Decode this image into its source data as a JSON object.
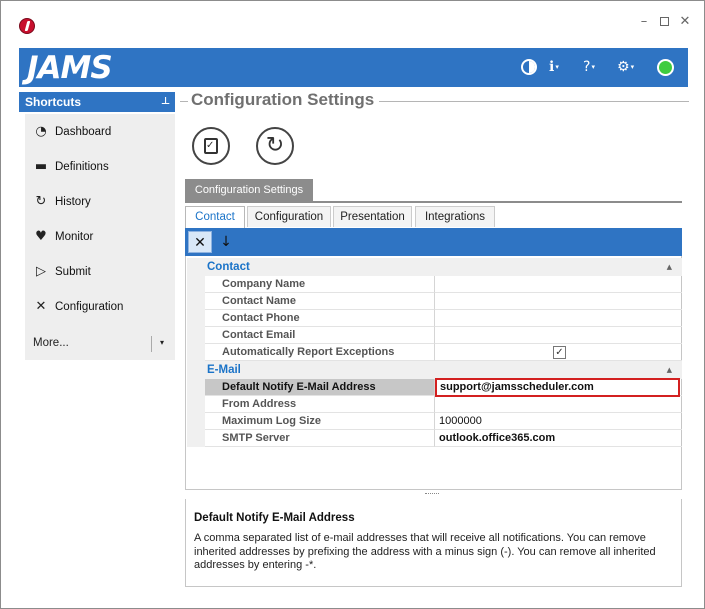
{
  "titlebar": {
    "minimize": "–",
    "maximize": "",
    "close": "✕"
  },
  "header": {
    "logo": "JAMS",
    "icons": [
      "contrast-icon",
      "info-icon",
      "help-icon",
      "settings-icon",
      "status-indicator"
    ],
    "info_glyph": "ℹ",
    "help_glyph": "?",
    "settings_glyph": "⚙",
    "caret": "▾",
    "status_color": "#3fcc3f",
    "accent": "#2f74c3"
  },
  "shortcuts": {
    "title": "Shortcuts",
    "pin": "⊥",
    "items": [
      {
        "label": "Dashboard",
        "icon": "dashboard-icon",
        "glyph": "◔"
      },
      {
        "label": "Definitions",
        "icon": "folder-icon",
        "glyph": "▬"
      },
      {
        "label": "History",
        "icon": "history-icon",
        "glyph": "↻"
      },
      {
        "label": "Monitor",
        "icon": "heart-monitor-icon",
        "glyph": "♥"
      },
      {
        "label": "Submit",
        "icon": "submit-icon",
        "glyph": "▷"
      },
      {
        "label": "Configuration",
        "icon": "tools-icon",
        "glyph": "✕"
      }
    ],
    "more_label": "More...",
    "more_caret": "▾"
  },
  "page": {
    "title": "Configuration Settings",
    "refresh_glyph": "↻"
  },
  "config_tab": "Configuration Settings",
  "tabs": [
    "Contact",
    "Configuration",
    "Presentation",
    "Integrations"
  ],
  "active_tab": "Contact",
  "grid_toolbar": {
    "categorized_glyph": "✕",
    "sort_glyph": "↓"
  },
  "grid": {
    "categories": [
      {
        "name": "Contact",
        "rows": [
          {
            "name": "Company Name",
            "value": ""
          },
          {
            "name": "Contact Name",
            "value": ""
          },
          {
            "name": "Contact Phone",
            "value": ""
          },
          {
            "name": "Contact Email",
            "value": ""
          },
          {
            "name": "Automatically Report Exceptions",
            "value": "✓"
          }
        ]
      },
      {
        "name": "E-Mail",
        "rows": [
          {
            "name": "Default Notify E-Mail Address",
            "value": "support@jamsscheduler.com"
          },
          {
            "name": "From Address",
            "value": ""
          },
          {
            "name": "Maximum Log Size",
            "value": "1000000"
          },
          {
            "name": "SMTP Server",
            "value": "outlook.office365.com"
          }
        ]
      }
    ],
    "collapse_glyph": "▲"
  },
  "description": {
    "title": "Default Notify E-Mail Address",
    "text": "A comma separated list of e-mail addresses that will receive all notifications. You can remove inherited addresses by prefixing the address with a minus sign (-). You can remove all inherited addresses by entering -*."
  }
}
